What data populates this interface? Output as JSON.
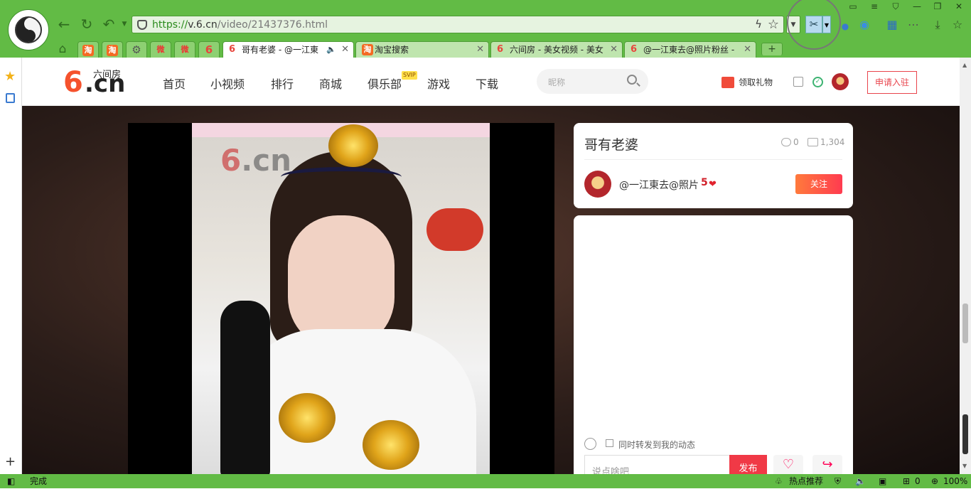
{
  "browser": {
    "url_prefix": "https://",
    "url_domain": "v.6.cn",
    "url_path": "/video/21437376.html",
    "tabs": [
      {
        "label": "哥有老婆 - @一江東",
        "active": true
      },
      {
        "label": "淘宝搜索",
        "active": false
      },
      {
        "label": "六间房 - 美女视频 - 美女",
        "active": false
      },
      {
        "label": "@一江東去@照片粉丝 -",
        "active": false
      }
    ],
    "new_tab": "+",
    "pinned_tab_labels": [
      "淘",
      "淘",
      "⚙",
      "微",
      "微",
      "6"
    ]
  },
  "site": {
    "logo_six": "6",
    "logo_cn": ".cn",
    "logo_name": "六间房",
    "menu": [
      "首页",
      "小视频",
      "排行",
      "商城",
      "俱乐部",
      "游戏",
      "下载"
    ],
    "svip_badge": "SVIP",
    "search_placeholder": "昵称",
    "gift_label": "领取礼物",
    "apply_label": "申请入驻"
  },
  "video": {
    "title": "哥有老婆",
    "comments": "0",
    "views": "1,304",
    "author": "@一江東去@照片",
    "level": "5",
    "follow_label": "关注",
    "watermark": ".cn",
    "watermark_six": "6"
  },
  "comment": {
    "forward_label": "同时转发到我的动态",
    "placeholder": "说点啥吧",
    "publish_label": "发布",
    "like_label": "点赞",
    "share_label": "分享"
  },
  "status": {
    "left_text": "完成",
    "hot": "热点推荐",
    "count": "0",
    "zoom": "100%"
  },
  "colors": {
    "browser_green": "#62bb45",
    "accent_red": "#f03946",
    "follow_gradient_start": "#ff7a3c"
  }
}
